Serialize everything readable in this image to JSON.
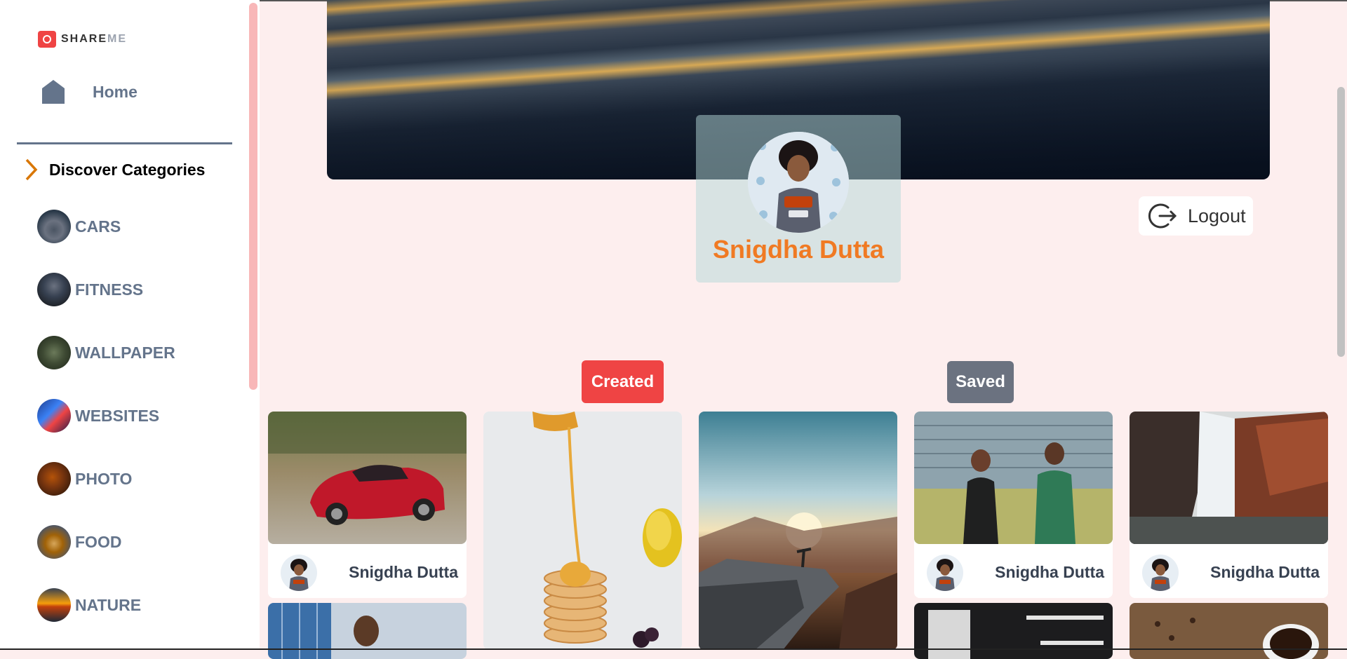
{
  "app": {
    "logo_text_a": "SHARE",
    "logo_text_b": "ME",
    "accent_color": "#ef4444",
    "name_color": "#f07a23"
  },
  "sidebar": {
    "home_label": "Home",
    "discover_label": "Discover Categories",
    "categories": [
      {
        "label": "CARS",
        "icon": "cars-thumbnail"
      },
      {
        "label": "FITNESS",
        "icon": "fitness-thumbnail"
      },
      {
        "label": "WALLPAPER",
        "icon": "wallpaper-thumbnail"
      },
      {
        "label": "WEBSITES",
        "icon": "websites-thumbnail"
      },
      {
        "label": "PHOTO",
        "icon": "photo-thumbnail"
      },
      {
        "label": "FOOD",
        "icon": "food-thumbnail"
      },
      {
        "label": "NATURE",
        "icon": "nature-thumbnail"
      }
    ]
  },
  "profile": {
    "name": "Snigdha Dutta",
    "logout_label": "Logout"
  },
  "tabs": {
    "created_label": "Created",
    "saved_label": "Saved"
  },
  "pins": [
    {
      "subject": "red sports car",
      "author": "Snigdha Dutta"
    },
    {
      "subject": "pancakes with honey",
      "author": ""
    },
    {
      "subject": "person on cliff at sunset",
      "author": ""
    },
    {
      "subject": "couple running",
      "author": "Snigdha Dutta"
    },
    {
      "subject": "waterfall",
      "author": "Snigdha Dutta"
    }
  ]
}
